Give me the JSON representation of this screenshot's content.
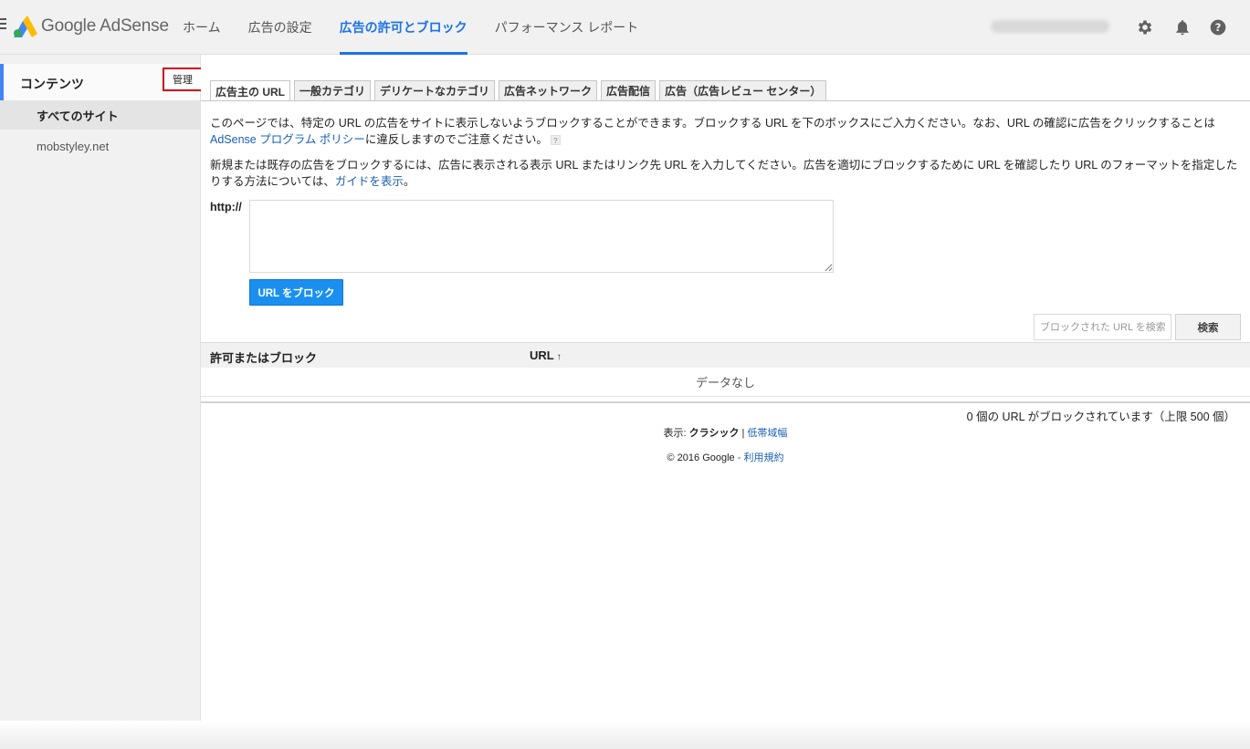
{
  "header": {
    "logo_text": "Google AdSense",
    "nav": [
      {
        "label": "ホーム",
        "active": false
      },
      {
        "label": "広告の設定",
        "active": false
      },
      {
        "label": "広告の許可とブロック",
        "active": true
      },
      {
        "label": "パフォーマンス レポート",
        "active": false
      }
    ],
    "icons": [
      "gear-icon",
      "bell-icon",
      "help-icon"
    ]
  },
  "sidebar": {
    "title": "コンテンツ",
    "manage_label": "管理",
    "items": [
      {
        "label": "すべてのサイト",
        "selected": true
      },
      {
        "label": "mobstyley.net",
        "selected": false
      }
    ]
  },
  "tabs": [
    {
      "label": "広告主の URL",
      "active": true
    },
    {
      "label": "一般カテゴリ",
      "active": false
    },
    {
      "label": "デリケートなカテゴリ",
      "active": false
    },
    {
      "label": "広告ネットワーク",
      "active": false
    },
    {
      "label": "広告配信",
      "active": false
    },
    {
      "label": "広告（広告レビュー センター）",
      "active": false
    }
  ],
  "content": {
    "para1_text": "このページでは、特定の URL の広告をサイトに表示しないようブロックすることができます。ブロックする URL を下のボックスにご入力ください。なお、URL の確認に広告をクリックすることは ",
    "para1_link": "AdSense プログラム ポリシー",
    "para1_after": "に違反しますのでご注意ください。",
    "help_mark": "?",
    "para2_text": "新規または既存の広告をブロックするには、広告に表示される表示 URL またはリンク先 URL を入力してください。広告を適切にブロックするために URL を確認したり URL のフォーマットを指定したりする方法については、",
    "para2_link": "ガイドを表示",
    "para2_after": "。",
    "http_label": "http://",
    "url_value": "",
    "block_button": "URL をブロック",
    "search_placeholder": "ブロックされた URL を検索",
    "search_button": "検索"
  },
  "table": {
    "columns": [
      "許可またはブロック",
      "URL"
    ],
    "sort_indicator": "↑",
    "empty_text": "データなし",
    "count_text": "0 個の URL がブロックされています（上限 500 個）"
  },
  "footer": {
    "view_prefix": "表示: ",
    "view_classic": "クラシック",
    "separator": " | ",
    "view_lowband": "低帯域幅",
    "copyright": "© 2016 Google",
    "dash": " - ",
    "terms": "利用規約"
  }
}
